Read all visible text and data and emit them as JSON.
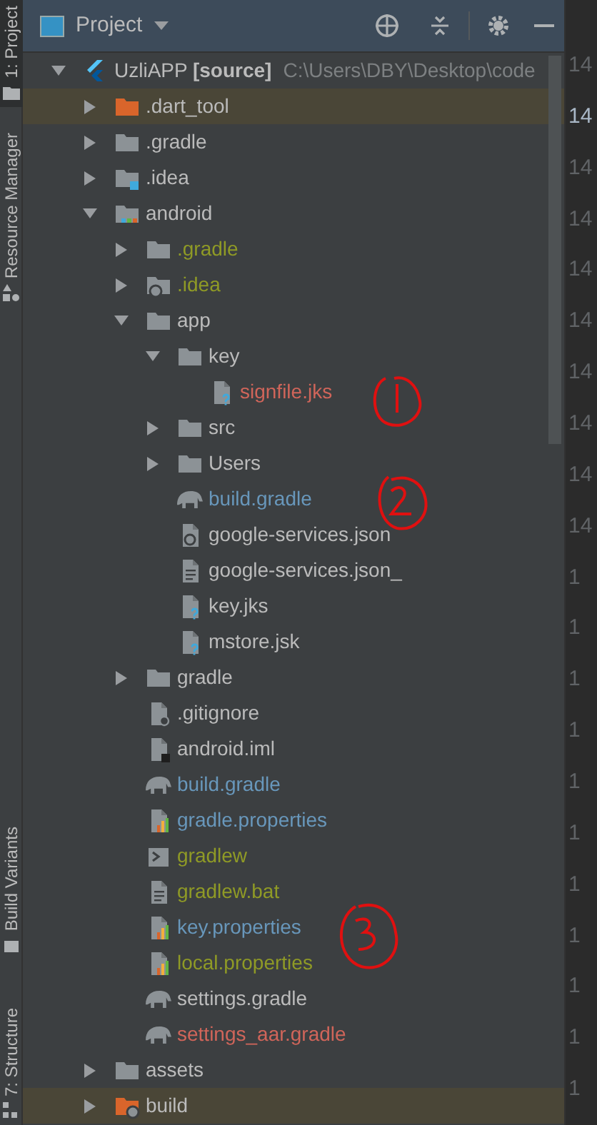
{
  "side_tabs": [
    {
      "label": "1: Project",
      "selected": true,
      "kind": "folder"
    },
    {
      "label": "Resource Manager",
      "selected": false,
      "kind": "shapes"
    },
    {
      "label": "Build Variants",
      "selected": false,
      "kind": "device"
    },
    {
      "label": "7: Structure",
      "selected": false,
      "kind": "structure"
    }
  ],
  "header": {
    "title": "Project"
  },
  "tree": {
    "name": "UzliAPP **[source]**",
    "path": "C:\\Users\\DBY\\Desktop\\code",
    "kind": "flutter",
    "color": "#bbbbbb",
    "expanded": true,
    "highlighted": false,
    "children": [
      {
        "name": ".dart_tool",
        "kind": "folder-excluded",
        "color": "#bbbbbb",
        "expanded": false,
        "highlighted": true
      },
      {
        "name": ".gradle",
        "kind": "folder",
        "color": "#bbbbbb",
        "expanded": false,
        "highlighted": false
      },
      {
        "name": ".idea",
        "kind": "folder-idea",
        "color": "#bbbbbb",
        "expanded": false,
        "highlighted": false
      },
      {
        "name": "android",
        "kind": "folder-module",
        "color": "#bbbbbb",
        "expanded": true,
        "highlighted": false,
        "children": [
          {
            "name": ".gradle",
            "kind": "folder",
            "color": "#8f9a26",
            "expanded": false,
            "highlighted": false
          },
          {
            "name": ".idea",
            "kind": "folder-gear",
            "color": "#8f9a26",
            "expanded": false,
            "highlighted": false
          },
          {
            "name": "app",
            "kind": "folder",
            "color": "#bbbbbb",
            "expanded": true,
            "highlighted": false,
            "children": [
              {
                "name": "key",
                "kind": "folder",
                "color": "#bbbbbb",
                "expanded": true,
                "highlighted": false,
                "children": [
                  {
                    "name": "signfile.jks",
                    "kind": "file-unknown",
                    "color": "#d0655a",
                    "highlighted": false
                  }
                ]
              },
              {
                "name": "src",
                "kind": "folder",
                "color": "#bbbbbb",
                "expanded": false,
                "highlighted": false
              },
              {
                "name": "Users",
                "kind": "folder",
                "color": "#bbbbbb",
                "expanded": false,
                "highlighted": false
              },
              {
                "name": "build.gradle",
                "kind": "gradle",
                "color": "#6897bb",
                "highlighted": false
              },
              {
                "name": "google-services.json",
                "kind": "json",
                "color": "#bbbbbb",
                "highlighted": false
              },
              {
                "name": "google-services.json_",
                "kind": "text",
                "color": "#bbbbbb",
                "highlighted": false
              },
              {
                "name": "key.jks",
                "kind": "file-unknown",
                "color": "#bbbbbb",
                "highlighted": false
              },
              {
                "name": "mstore.jsk",
                "kind": "file-unknown",
                "color": "#bbbbbb",
                "highlighted": false
              }
            ]
          },
          {
            "name": "gradle",
            "kind": "folder",
            "color": "#bbbbbb",
            "expanded": false,
            "highlighted": false
          },
          {
            "name": ".gitignore",
            "kind": "gitignore",
            "color": "#bbbbbb",
            "highlighted": false
          },
          {
            "name": "android.iml",
            "kind": "iml",
            "color": "#bbbbbb",
            "highlighted": false
          },
          {
            "name": "build.gradle",
            "kind": "gradle",
            "color": "#6897bb",
            "highlighted": false
          },
          {
            "name": "gradle.properties",
            "kind": "properties",
            "color": "#6897bb",
            "highlighted": false
          },
          {
            "name": "gradlew",
            "kind": "shell",
            "color": "#8f9a26",
            "highlighted": false
          },
          {
            "name": "gradlew.bat",
            "kind": "text",
            "color": "#8f9a26",
            "highlighted": false
          },
          {
            "name": "key.properties",
            "kind": "properties",
            "color": "#6897bb",
            "highlighted": false
          },
          {
            "name": "local.properties",
            "kind": "properties",
            "color": "#8f9a26",
            "highlighted": false
          },
          {
            "name": "settings.gradle",
            "kind": "gradle",
            "color": "#bbbbbb",
            "highlighted": false
          },
          {
            "name": "settings_aar.gradle",
            "kind": "gradle",
            "color": "#d0655a",
            "highlighted": false
          }
        ]
      },
      {
        "name": "assets",
        "kind": "folder",
        "color": "#bbbbbb",
        "expanded": false,
        "highlighted": false
      },
      {
        "name": "build",
        "kind": "folder-excluded-gear",
        "color": "#bbbbbb",
        "expanded": false,
        "highlighted": true
      }
    ]
  },
  "gutter": {
    "line_numbers": [
      "14",
      "14",
      "14",
      "14",
      "14",
      "14",
      "14",
      "14",
      "14",
      "14",
      "1",
      "1",
      "1",
      "1",
      "1",
      "1",
      "1",
      "1",
      "1",
      "1",
      "1"
    ]
  }
}
